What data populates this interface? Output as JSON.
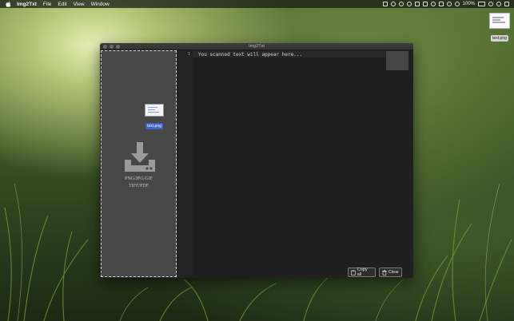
{
  "menubar": {
    "app_name": "Img2Txt",
    "items": [
      "File",
      "Edit",
      "View",
      "Window"
    ],
    "battery": "100%"
  },
  "desktop": {
    "file_label": "text.png"
  },
  "window": {
    "title": "Img2Txt",
    "dropzone": {
      "dragged_file_label": "text.png",
      "formats_line1": "PNG/JPG/GIF",
      "formats_line2": "TIFF/PDF"
    },
    "editor": {
      "line_number": "1",
      "placeholder_text": "You scanned text will appear here..."
    },
    "buttons": {
      "copy_all": "Copy all",
      "clear": "Clear"
    }
  },
  "colors": {
    "window_bg": "#262626",
    "dropzone_bg": "#474747",
    "editor_bg": "#1f1f1f",
    "selection_blue": "#3b63c9"
  }
}
